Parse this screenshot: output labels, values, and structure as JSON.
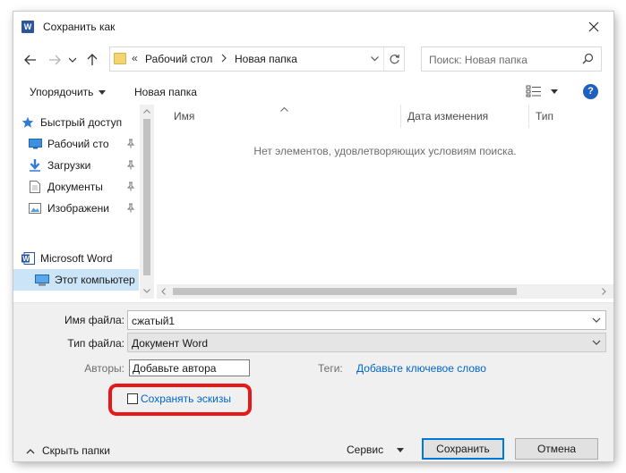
{
  "window": {
    "title": "Сохранить как",
    "app_icon_letter": "W"
  },
  "nav": {
    "address": {
      "prefix": "«",
      "segments": [
        "Рабочий стол",
        "Новая папка"
      ]
    },
    "search_placeholder": "Поиск: Новая папка"
  },
  "toolbar": {
    "organize_label": "Упорядочить",
    "new_folder_label": "Новая папка",
    "help_label": "?"
  },
  "sidebar": {
    "items": [
      {
        "label": "Быстрый доступ",
        "icon": "star-icon",
        "pinned": false
      },
      {
        "label": "Рабочий сто",
        "icon": "desktop-icon",
        "pinned": true
      },
      {
        "label": "Загрузки",
        "icon": "download-icon",
        "pinned": true
      },
      {
        "label": "Документы",
        "icon": "document-icon",
        "pinned": true
      },
      {
        "label": "Изображени",
        "icon": "pictures-icon",
        "pinned": true
      },
      {
        "label": "Microsoft Word",
        "icon": "word-icon",
        "pinned": false
      },
      {
        "label": "Этот компьютер",
        "icon": "computer-icon",
        "pinned": false,
        "selected": true
      }
    ]
  },
  "filelist": {
    "columns": [
      "Имя",
      "Дата изменения",
      "Тип"
    ],
    "empty_message": "Нет элементов, удовлетворяющих условиям поиска."
  },
  "form": {
    "filename_label": "Имя файла:",
    "filename_value": "сжатый1",
    "filetype_label": "Тип файла:",
    "filetype_value": "Документ Word",
    "authors_label": "Авторы:",
    "authors_value": "Добавьте автора",
    "tags_label": "Теги:",
    "tags_value": "Добавьте ключевое слово",
    "thumbnails_label": "Сохранять эскизы",
    "thumbnails_checked": false
  },
  "footer": {
    "hide_folders_label": "Скрыть папки",
    "service_label": "Сервис",
    "save_label": "Сохранить",
    "cancel_label": "Отмена"
  },
  "colors": {
    "accent": "#0078d7",
    "link": "#0066cc",
    "highlight": "#e81818",
    "selection": "#cce4f7"
  }
}
